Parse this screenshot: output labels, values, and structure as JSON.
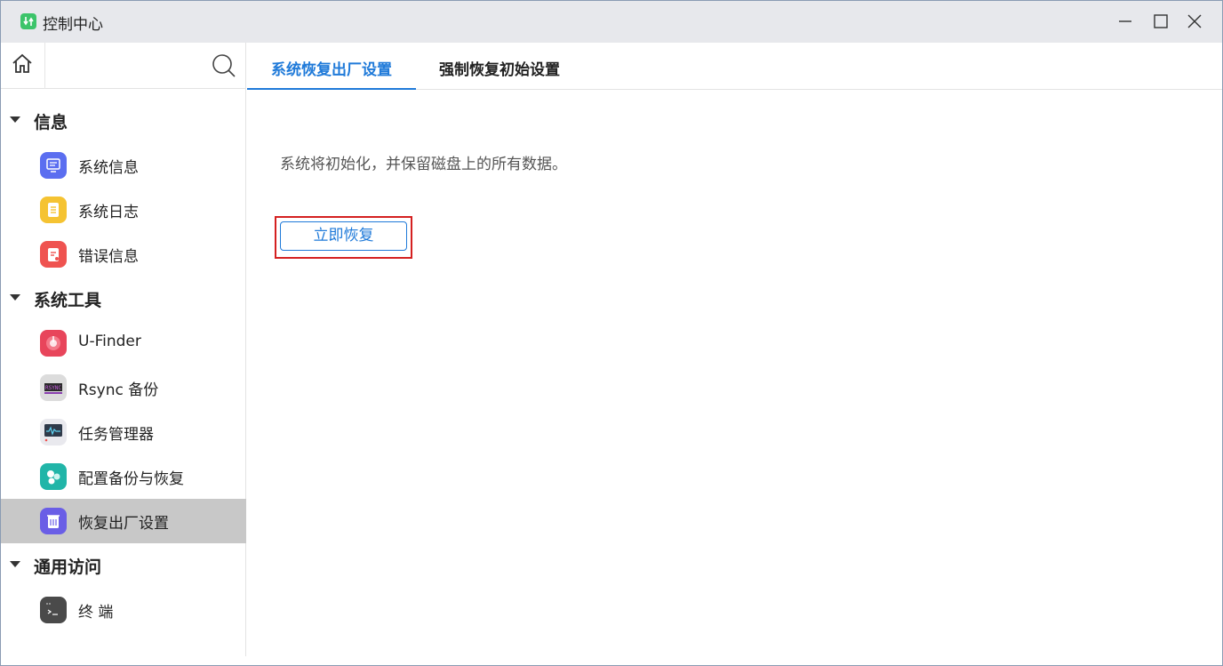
{
  "window": {
    "title": "控制中心",
    "controls": [
      "minimize-icon",
      "maximize-icon",
      "close-icon"
    ]
  },
  "sidebar": {
    "groups": [
      {
        "label": "信息",
        "items": [
          {
            "label": "系统信息",
            "icon": "system-info-icon",
            "color": "#5b6ef0"
          },
          {
            "label": "系统日志",
            "icon": "system-log-icon",
            "color": "#f5c332"
          },
          {
            "label": "错误信息",
            "icon": "error-info-icon",
            "color": "#ef5350"
          }
        ]
      },
      {
        "label": "系统工具",
        "items": [
          {
            "label": "U-Finder",
            "icon": "u-finder-icon",
            "color": "#e8455b"
          },
          {
            "label": "Rsync 备份",
            "icon": "rsync-icon",
            "color": "#dcdcdc"
          },
          {
            "label": "任务管理器",
            "icon": "task-manager-icon",
            "color": "#e9e9ee"
          },
          {
            "label": "配置备份与恢复",
            "icon": "config-backup-icon",
            "color": "#21b5a8"
          },
          {
            "label": "恢复出厂设置",
            "icon": "factory-reset-icon",
            "color": "#6a5ee6",
            "active": true
          }
        ]
      },
      {
        "label": "通用访问",
        "items": [
          {
            "label": "终 端",
            "icon": "terminal-icon",
            "color": "#4a4a4a"
          }
        ]
      }
    ]
  },
  "tabs": [
    {
      "label": "系统恢复出厂设置",
      "active": true
    },
    {
      "label": "强制恢复初始设置",
      "active": false
    }
  ],
  "content": {
    "description": "系统将初始化，并保留磁盘上的所有数据。",
    "restore_button": "立即恢复"
  },
  "colors": {
    "accent": "#1f7ad9",
    "highlight": "#d42020",
    "active_item_bg": "#c8c8c8"
  }
}
